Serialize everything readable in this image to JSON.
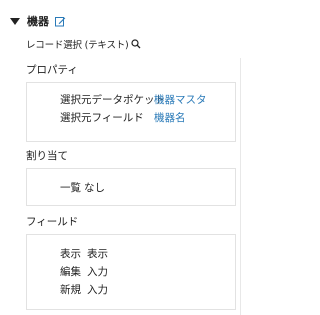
{
  "header": {
    "title": "機器",
    "edit_icon": "edit-icon"
  },
  "subtitle": {
    "text": "レコード選択 (テキスト)",
    "icon": "search-icon"
  },
  "properties": {
    "title": "プロパティ",
    "rows": [
      {
        "label": "選択元データポケット",
        "value": "機器マスタ"
      },
      {
        "label": "選択元フィールド",
        "value": "機器名"
      }
    ]
  },
  "assign": {
    "title": "割り当て",
    "rows": [
      {
        "label": "一覧",
        "value": "なし"
      }
    ]
  },
  "fields": {
    "title": "フィールド",
    "rows": [
      {
        "label": "表示",
        "value": "表示"
      },
      {
        "label": "編集",
        "value": "入力"
      },
      {
        "label": "新規",
        "value": "入力"
      }
    ]
  },
  "colors": {
    "link": "#2a7ab8",
    "border": "#e2e2e2",
    "text": "#222222"
  }
}
